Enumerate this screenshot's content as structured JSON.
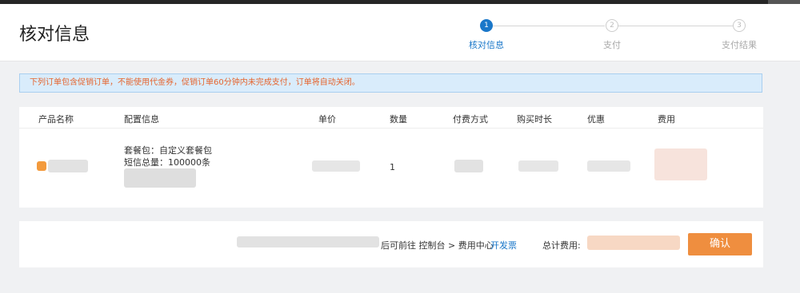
{
  "header": {
    "title": "核对信息",
    "steps": [
      {
        "number": "1",
        "label": "核对信息",
        "state": "active"
      },
      {
        "number": "2",
        "label": "支付",
        "state": "idle"
      },
      {
        "number": "3",
        "label": "支付结果",
        "state": "idle"
      }
    ]
  },
  "notice": {
    "text": "下列订单包含促销订单，不能使用代金券，促销订单60分钟内未完成支付，订单将自动关闭。"
  },
  "table": {
    "columns": [
      "产品名称",
      "配置信息",
      "单价",
      "数量",
      "付费方式",
      "购买时长",
      "优惠",
      "费用"
    ],
    "row": {
      "config_line1": "套餐包：自定义套餐包",
      "config_line2": "短信总量：100000条",
      "quantity": "1"
    }
  },
  "footer": {
    "text_prefix": "后可前往 控制台 > 费用中心",
    "invoice_link": "开发票",
    "total_label": "总计费用:",
    "submit_label": "确认"
  },
  "colors": {
    "accent": "#1a77c9",
    "notice_text": "#e5642d",
    "notice_bg": "#d9ecfb",
    "button": "#ef8e3f"
  }
}
